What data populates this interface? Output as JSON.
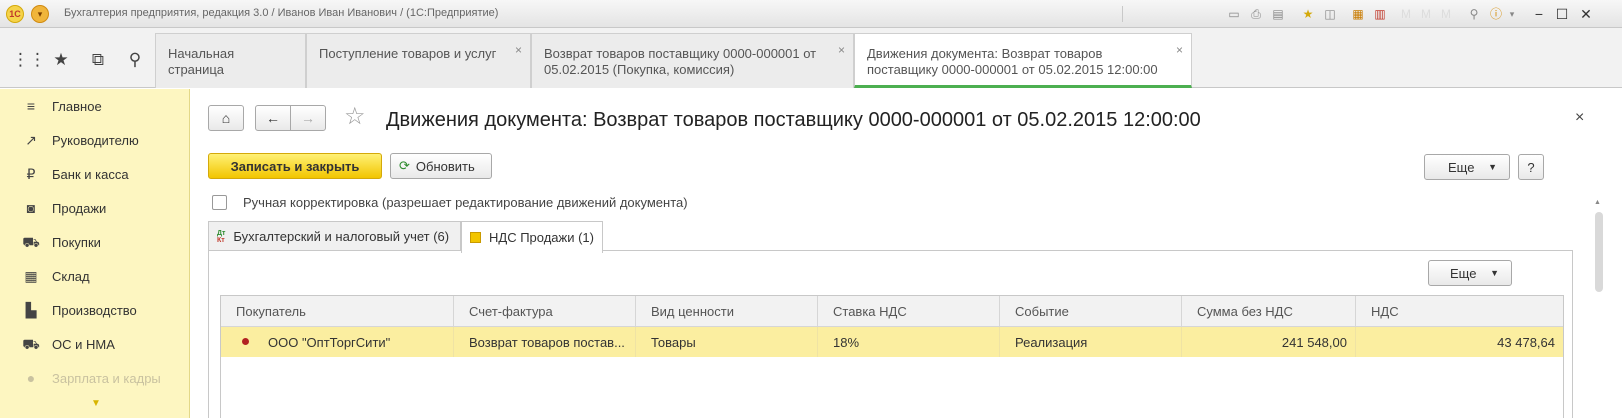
{
  "titlebar": {
    "title": "Бухгалтерия предприятия, редакция 3.0 / Иванов Иван Иванович / (1С:Предприятие)",
    "app": "(1С:Предприятие)",
    "logo_text": "1С"
  },
  "sections": {
    "tabs": [
      {
        "label": "Начальная страница",
        "closable": false
      },
      {
        "label": "Поступление товаров и услуг",
        "closable": true
      },
      {
        "label": "Возврат товаров поставщику 0000-000001 от 05.02.2015 (Покупка, комиссия)",
        "closable": true
      },
      {
        "label": "Движения документа: Возврат товаров поставщику 0000-000001 от 05.02.2015 12:00:00",
        "closable": true,
        "active": true
      }
    ],
    "close_glyph": "×"
  },
  "nav": {
    "items": [
      {
        "label": "Главное",
        "icon": "menu-lines-icon"
      },
      {
        "label": "Руководителю",
        "icon": "trend-icon"
      },
      {
        "label": "Банк и касса",
        "icon": "ruble-icon"
      },
      {
        "label": "Продажи",
        "icon": "bag-icon"
      },
      {
        "label": "Покупки",
        "icon": "cart-icon"
      },
      {
        "label": "Склад",
        "icon": "warehouse-icon"
      },
      {
        "label": "Производство",
        "icon": "factory-icon"
      },
      {
        "label": "ОС и НМА",
        "icon": "truck-icon"
      },
      {
        "label": "Зарплата и кадры",
        "icon": "person-icon"
      }
    ]
  },
  "document": {
    "title": "Движения документа: Возврат товаров поставщику 0000-000001 от 05.02.2015 12:00:00",
    "save_close_label": "Записать и закрыть",
    "refresh_label": "Обновить",
    "more_label": "Еще",
    "help_label": "?",
    "manual_label": "Ручная корректировка (разрешает редактирование движений документа)",
    "manual_checked": false
  },
  "panel_tabs": [
    {
      "label": "Бухгалтерский и налоговый учет (6)",
      "icon": "dt-kt-icon"
    },
    {
      "label": "НДС Продажи (1)",
      "icon": "vat-register-icon",
      "active": true
    }
  ],
  "table": {
    "more_label": "Еще",
    "columns": [
      "Покупатель",
      "Счет-фактура",
      "Вид ценности",
      "Ставка НДС",
      "Событие",
      "Сумма без НДС",
      "НДС"
    ],
    "rows": [
      [
        "ООО \"ОптТоргСити\"",
        "Возврат товаров постав...",
        "Товары",
        "18%",
        "Реализация",
        "241 548,00",
        "43 478,64"
      ]
    ]
  },
  "colors": {
    "accent_yellow": "#f2c500",
    "panel_bg": "#fdf6c1",
    "selected_row": "#fbeea0",
    "active_tab_bar": "#4caf50"
  }
}
